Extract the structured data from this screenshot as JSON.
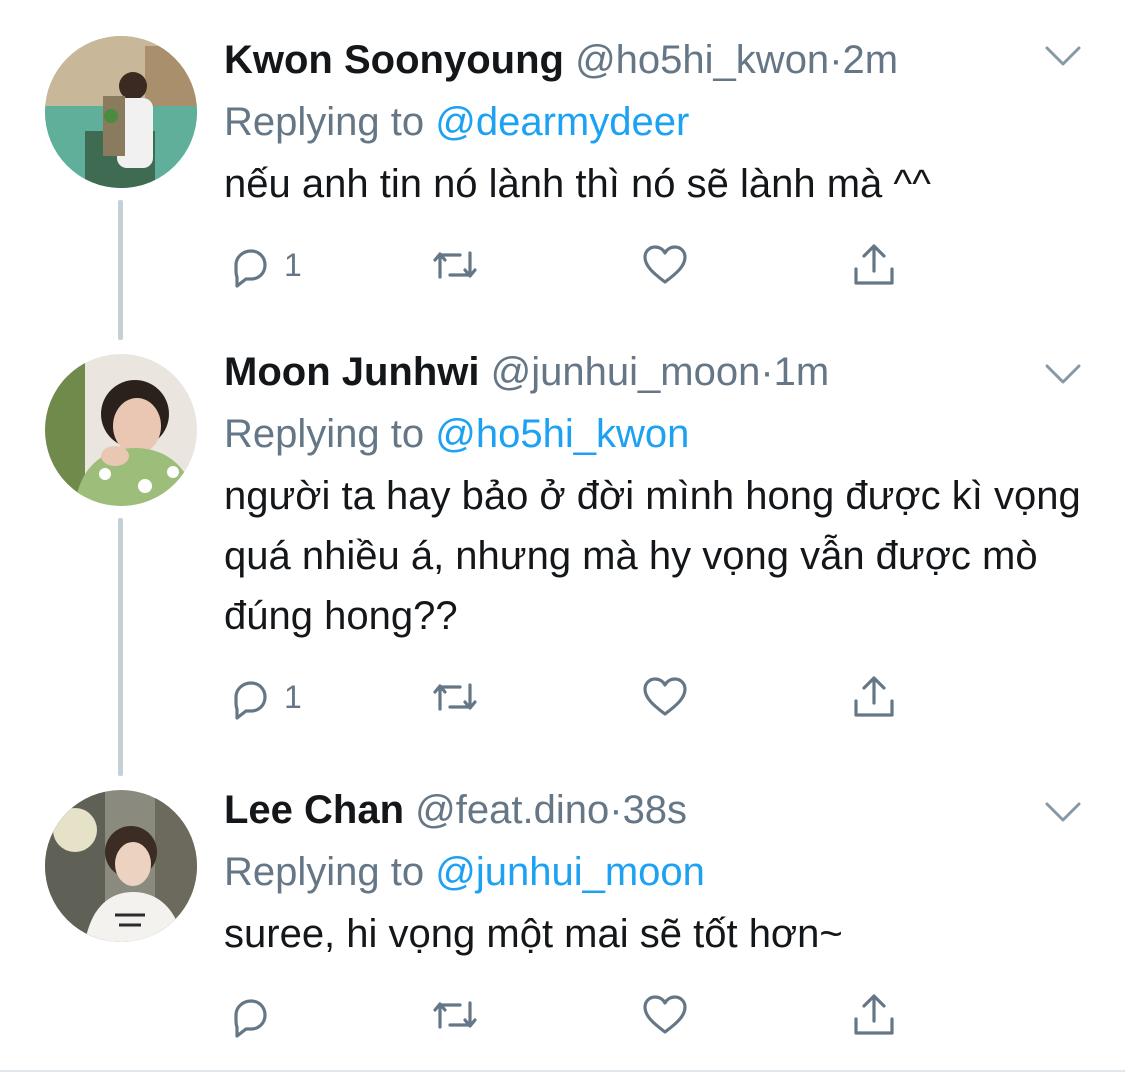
{
  "tweets": [
    {
      "name": "Kwon Soonyoung",
      "handle": "@ho5hi_kwon",
      "separator": "·",
      "time": "2m",
      "replying_label": "Replying to",
      "replying_to": "@dearmydeer",
      "text": "nếu anh tin nó lành thì nó sẽ lành mà ^^",
      "reply_count": "1"
    },
    {
      "name": "Moon Junhwi",
      "handle": "@junhui_moon",
      "separator": "·",
      "time": "1m",
      "replying_label": "Replying to",
      "replying_to": "@ho5hi_kwon",
      "text": "người ta hay bảo ở đời mình hong được kì vọng quá nhiều á, nhưng mà hy vọng vẫn được mò đúng hong??",
      "reply_count": "1"
    },
    {
      "name": "Lee Chan",
      "handle": "@feat.dino",
      "separator": "·",
      "time": "38s",
      "replying_label": "Replying to",
      "replying_to": "@junhui_moon",
      "text": "suree, hi vọng một mai sẽ tốt hơn~",
      "reply_count": ""
    }
  ],
  "icons": [
    "reply-icon",
    "retweet-icon",
    "like-icon",
    "share-icon",
    "chevron-down-icon"
  ],
  "colors": {
    "text": "#14171a",
    "secondary": "#657786",
    "link": "#1da1f2",
    "thread_line": "#c4cfd6"
  }
}
